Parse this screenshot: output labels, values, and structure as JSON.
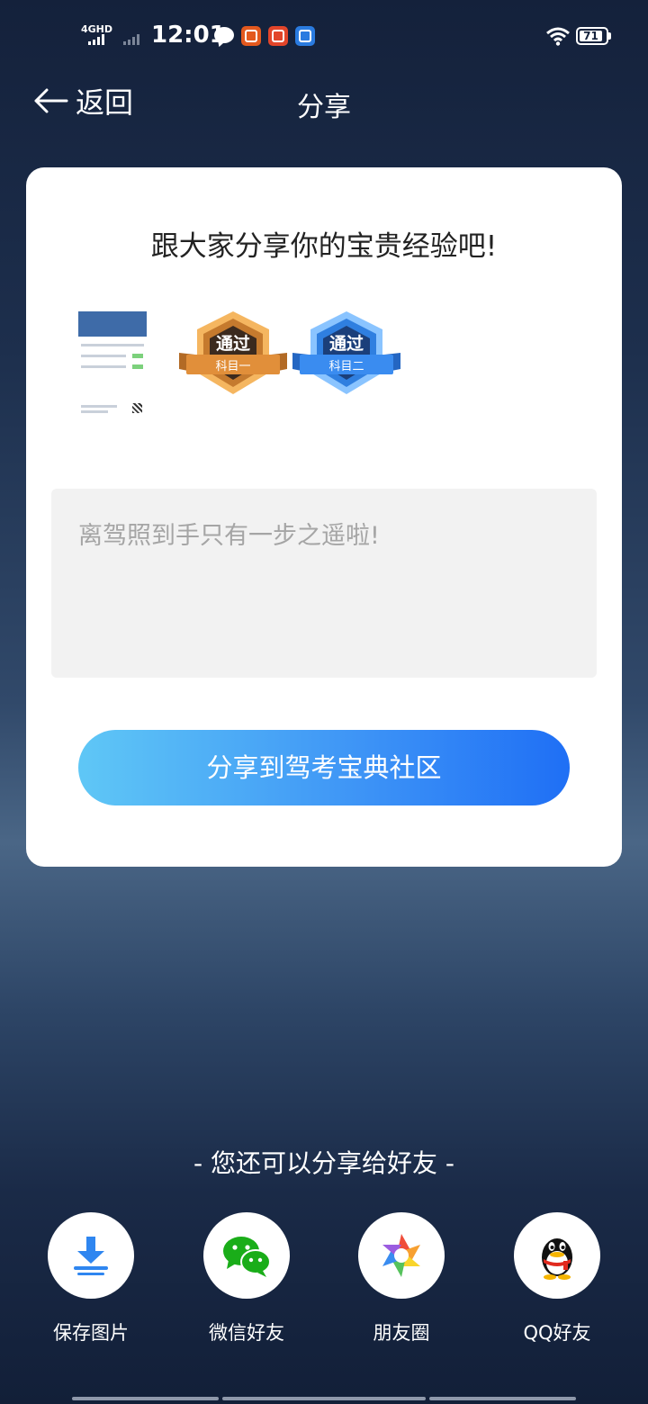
{
  "status_bar": {
    "network": "4GHD",
    "time": "12:01",
    "battery": "71"
  },
  "nav": {
    "back_label": "返回",
    "title": "分享"
  },
  "card": {
    "heading": "跟大家分享你的宝贵经验吧!",
    "badges": [
      {
        "top": "通过",
        "bottom": "科目一",
        "color": "#c97a2c"
      },
      {
        "top": "通过",
        "bottom": "科目二",
        "color": "#2f7fe0"
      }
    ],
    "textarea_placeholder": "离驾照到手只有一步之遥啦!",
    "share_button": "分享到驾考宝典社区"
  },
  "friends": {
    "title": "- 您还可以分享给好友 -",
    "items": [
      {
        "label": "保存图片",
        "icon": "download-icon"
      },
      {
        "label": "微信好友",
        "icon": "wechat-icon"
      },
      {
        "label": "朋友圈",
        "icon": "moments-icon"
      },
      {
        "label": "QQ好友",
        "icon": "qq-icon"
      }
    ]
  },
  "colors": {
    "accent_start": "#5fc7f6",
    "accent_end": "#1f6ff5"
  }
}
